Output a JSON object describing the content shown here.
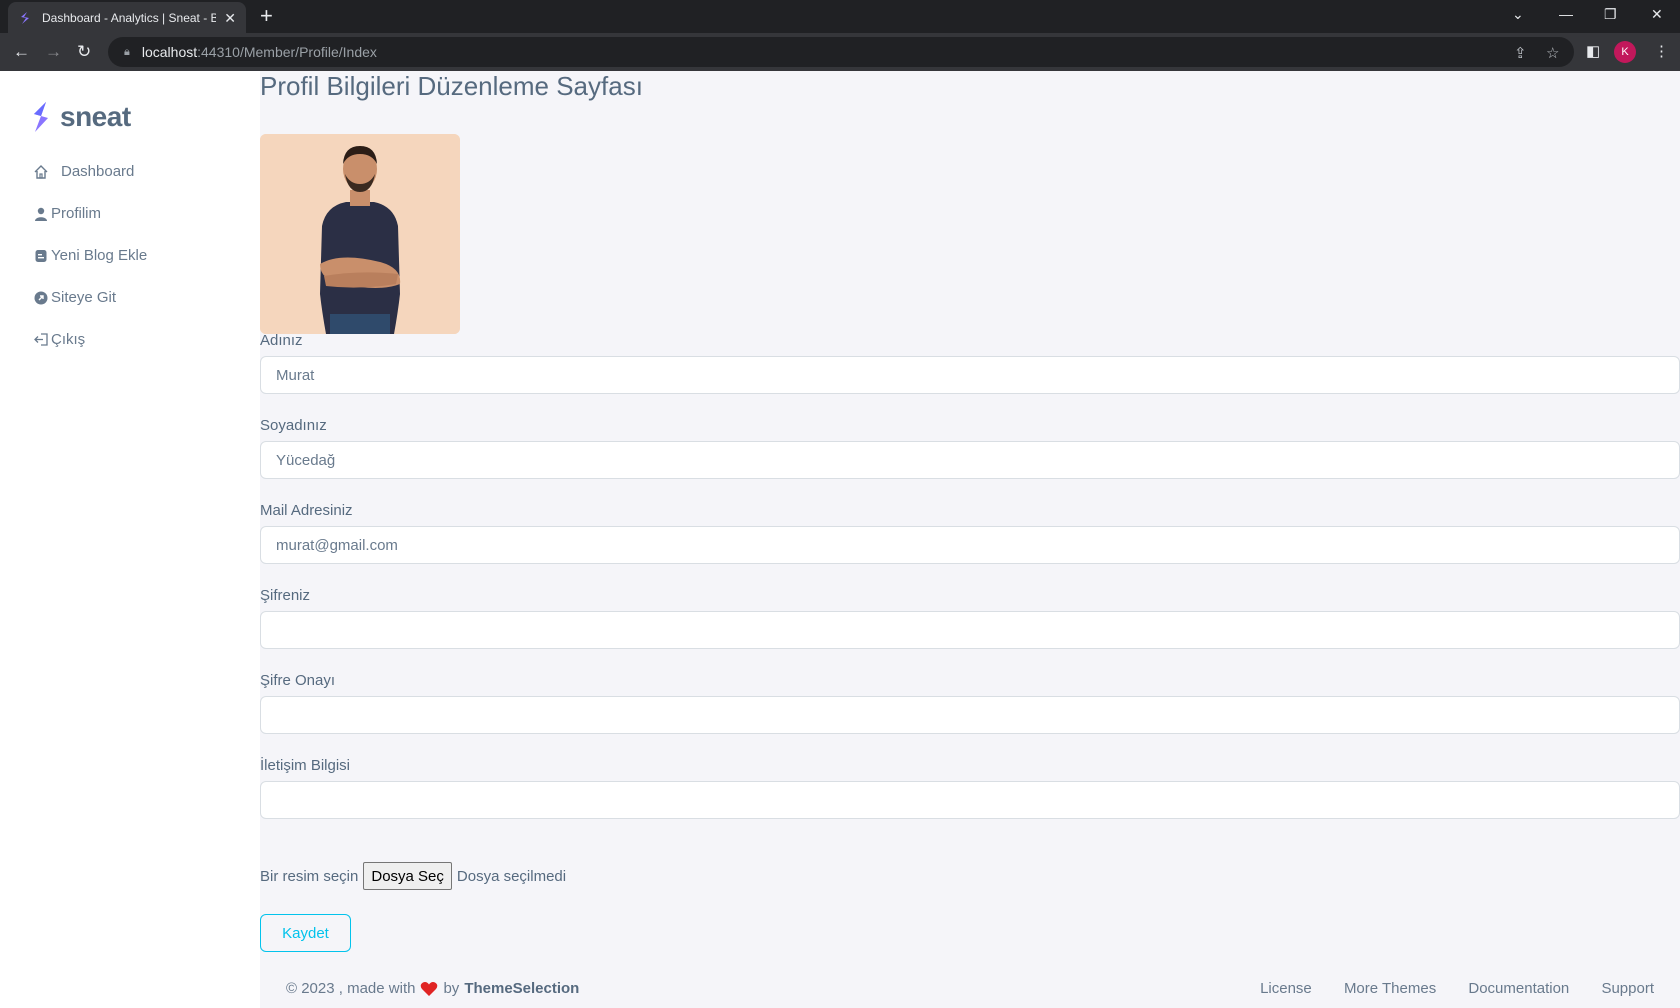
{
  "browser": {
    "tab_title": "Dashboard - Analytics | Sneat - B",
    "url_host": "localhost",
    "url_rest": ":44310/Member/Profile/Index",
    "profile_initial": "K"
  },
  "sidebar": {
    "brand": "sneat",
    "items": [
      {
        "label": "Dashboard",
        "icon": "home-icon"
      },
      {
        "label": "Profilim",
        "icon": "user-icon"
      },
      {
        "label": "Yeni Blog Ekle",
        "icon": "blog-icon"
      },
      {
        "label": "Siteye Git",
        "icon": "arrow-circle-icon"
      },
      {
        "label": "Çıkış",
        "icon": "logout-icon"
      }
    ]
  },
  "page": {
    "title": "Profil Bilgileri Düzenleme Sayfası",
    "fields": [
      {
        "label": "Adınız",
        "value": ""
      },
      {
        "label": "Soyadınız",
        "value": ""
      },
      {
        "label": "Mail Adresiniz",
        "value": ""
      },
      {
        "label": "Şifreniz",
        "value": ""
      },
      {
        "label": "Şifre Onayı",
        "value": ""
      },
      {
        "label": "İletişim Bilgisi",
        "value": ""
      }
    ],
    "first_name": "Murat",
    "last_name": "Yücedağ",
    "email": "murat@gmail.com",
    "file_label": "Bir resim seçin",
    "file_button": "Dosya Seç",
    "file_status": "Dosya seçilmedi",
    "save_button": "Kaydet"
  },
  "footer": {
    "copyright": "© 2023 , made with",
    "by": "by",
    "brand": "ThemeSelection",
    "links": [
      "License",
      "More Themes",
      "Documentation",
      "Support"
    ]
  },
  "colors": {
    "accent": "#696cff",
    "info": "#03c3ec",
    "heart": "#ff3e1d"
  }
}
